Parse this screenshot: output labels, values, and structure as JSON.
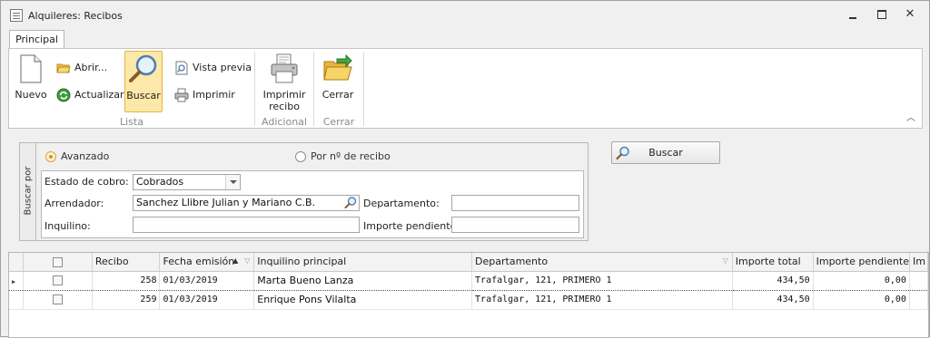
{
  "window": {
    "title": "Alquileres: Recibos",
    "close_glyph": "✕"
  },
  "ribbon": {
    "tab_label": "Principal",
    "groups": {
      "lista": {
        "label": "Lista",
        "nuevo": "Nuevo",
        "abrir": "Abrir...",
        "actualizar": "Actualizar",
        "buscar": "Buscar",
        "vista_previa": "Vista previa",
        "imprimir": "Imprimir"
      },
      "adicional": {
        "label": "Adicional",
        "imprimir_recibo_line1": "Imprimir",
        "imprimir_recibo_line2": "recibo"
      },
      "cerrar": {
        "label": "Cerrar",
        "cerrar": "Cerrar"
      }
    }
  },
  "search": {
    "side_label": "Buscar por",
    "mode_avanzado": "Avanzado",
    "mode_por_recibo": "Por nº de recibo",
    "selected_mode": "Avanzado",
    "estado_cobro_label": "Estado de cobro:",
    "estado_cobro_value": "Cobrados",
    "arrendador_label": "Arrendador:",
    "arrendador_value": "Sanchez Llibre Julian y Mariano C.B.",
    "departamento_label": "Departamento:",
    "departamento_value": "",
    "inquilino_label": "Inquilino:",
    "inquilino_value": "",
    "importe_pendiente_label": "Importe pendiente:",
    "importe_pendiente_value": "",
    "button_label": "Buscar"
  },
  "grid": {
    "columns": {
      "recibo": "Recibo",
      "fecha_emision": "Fecha emisión",
      "inquilino_principal": "Inquilino principal",
      "departamento": "Departamento",
      "importe_total": "Importe total",
      "importe_pendiente": "Importe pendiente",
      "overflow": "Im"
    },
    "rows": [
      {
        "recibo": "258",
        "fecha": "01/03/2019",
        "inquilino": "Marta Bueno Lanza",
        "departamento": "Trafalgar, 121, PRIMERO 1",
        "importe_total": "434,50",
        "importe_pendiente": "0,00"
      },
      {
        "recibo": "259",
        "fecha": "01/03/2019",
        "inquilino": "Enrique Pons Vilalta",
        "departamento": "Trafalgar, 121, PRIMERO 1",
        "importe_total": "434,50",
        "importe_pendiente": "0,00"
      }
    ]
  },
  "colors": {
    "accent_active": "#fce8a8",
    "accent_border": "#e1b64b",
    "window_bg": "#f0f0f0"
  }
}
